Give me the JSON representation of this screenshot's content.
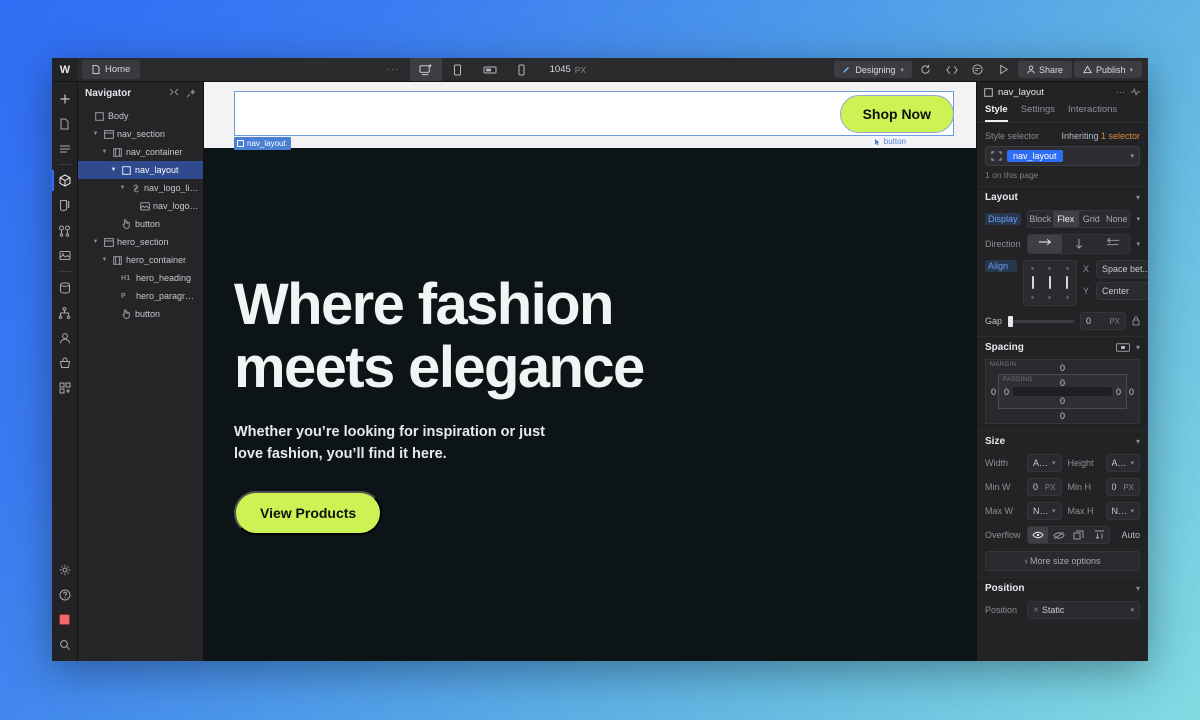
{
  "app": {
    "logo": "W",
    "page_tab": "Home",
    "canvas_width": "1045",
    "canvas_width_unit": "PX",
    "mode_label": "Designing",
    "share_label": "Share",
    "publish_label": "Publish",
    "overflow_dots": "···"
  },
  "rail": {
    "items": [
      {
        "name": "add-panel",
        "icon": "plus-icon"
      },
      {
        "name": "pages-panel",
        "icon": "page-icon"
      },
      {
        "name": "navigator-panel",
        "icon": "layers-icon"
      },
      {
        "name": "components-panel",
        "icon": "cube-icon"
      },
      {
        "name": "style-manager-panel",
        "icon": "paint-icon"
      },
      {
        "name": "variables-panel",
        "icon": "variables-icon"
      },
      {
        "name": "assets-panel",
        "icon": "image-icon"
      },
      {
        "name": "cms-panel",
        "icon": "database-icon"
      },
      {
        "name": "logic-panel",
        "icon": "logic-icon"
      },
      {
        "name": "users-panel",
        "icon": "user-icon"
      },
      {
        "name": "ecommerce-panel",
        "icon": "cart-icon"
      },
      {
        "name": "apps-panel",
        "icon": "apps-icon"
      }
    ],
    "bottom": [
      {
        "name": "settings",
        "icon": "gear-icon"
      },
      {
        "name": "help",
        "icon": "question-icon"
      },
      {
        "name": "color-swatch",
        "icon": "swatch-icon"
      },
      {
        "name": "search",
        "icon": "search-icon"
      }
    ]
  },
  "navigator": {
    "title": "Navigator",
    "tree": [
      {
        "label": "Body",
        "depth": 0,
        "icon": "box-icon",
        "twist": "",
        "selected": false,
        "tag": ""
      },
      {
        "label": "nav_section",
        "depth": 1,
        "icon": "section-icon",
        "twist": "v",
        "selected": false,
        "tag": ""
      },
      {
        "label": "nav_container",
        "depth": 2,
        "icon": "container-icon",
        "twist": "v",
        "selected": false,
        "tag": ""
      },
      {
        "label": "nav_layout",
        "depth": 3,
        "icon": "box-icon",
        "twist": "v",
        "selected": true,
        "tag": ""
      },
      {
        "label": "nav_logo_link",
        "depth": 4,
        "icon": "link-icon",
        "twist": "v",
        "selected": false,
        "tag": ""
      },
      {
        "label": "nav_logo_ima…",
        "depth": 5,
        "icon": "image-icon",
        "twist": "",
        "selected": false,
        "tag": ""
      },
      {
        "label": "button",
        "depth": 3,
        "icon": "pointer-icon",
        "twist": "",
        "selected": false,
        "tag": ""
      },
      {
        "label": "hero_section",
        "depth": 1,
        "icon": "section-icon",
        "twist": "v",
        "selected": false,
        "tag": ""
      },
      {
        "label": "hero_container",
        "depth": 2,
        "icon": "container-icon",
        "twist": "v",
        "selected": false,
        "tag": ""
      },
      {
        "label": "hero_heading",
        "depth": 3,
        "icon": "",
        "twist": "",
        "selected": false,
        "tag": "H1"
      },
      {
        "label": "hero_paragraph",
        "depth": 3,
        "icon": "",
        "twist": "",
        "selected": false,
        "tag": "P"
      },
      {
        "label": "button",
        "depth": 3,
        "icon": "pointer-icon",
        "twist": "",
        "selected": false,
        "tag": ""
      }
    ]
  },
  "canvas": {
    "nav_badge": "nav_layout",
    "button_badge": "button",
    "shop_button": "Shop Now",
    "hero_heading_line1": "Where fashion",
    "hero_heading_line2": "meets elegance",
    "hero_paragraph_line1": "Whether you’re looking for inspiration or just",
    "hero_paragraph_line2": "love fashion, you’ll find it here.",
    "hero_button": "View Products",
    "accent_color": "#ccf254",
    "hero_bg": "#0c1418",
    "selection_blue": "#4a7fd4"
  },
  "style_panel": {
    "element_name": "nav_layout",
    "tabs": [
      {
        "label": "Style",
        "active": true
      },
      {
        "label": "Settings",
        "active": false
      },
      {
        "label": "Interactions",
        "active": false
      }
    ],
    "selector": {
      "label": "Style selector",
      "inherit_prefix": "Inheriting ",
      "inherit_link": "1 selector",
      "chip": "nav_layout",
      "note": "1 on this page"
    },
    "layout": {
      "title": "Layout",
      "display_label": "Display",
      "display_options": [
        "Block",
        "Flex",
        "Grid",
        "None"
      ],
      "display_selected": "Flex",
      "direction_label": "Direction",
      "direction_selected": "row",
      "align_label": "Align",
      "align_x_label": "X",
      "align_x_value": "Space bet...",
      "align_y_label": "Y",
      "align_y_value": "Center",
      "gap_label": "Gap",
      "gap_value": "0",
      "gap_unit": "PX"
    },
    "spacing": {
      "title": "Spacing",
      "margin_label": "MARGIN",
      "padding_label": "PADDING",
      "margin_top": "0",
      "margin_right": "0",
      "margin_bottom": "0",
      "margin_left": "0",
      "padding_top": "0",
      "padding_right": "0",
      "padding_bottom": "0",
      "padding_left": "0"
    },
    "size": {
      "title": "Size",
      "width_label": "Width",
      "width_value": "Auto",
      "height_label": "Height",
      "height_value": "Auto",
      "minw_label": "Min W",
      "minw_value": "0",
      "minw_unit": "PX",
      "minh_label": "Min H",
      "minh_value": "0",
      "minh_unit": "PX",
      "maxw_label": "Max W",
      "maxw_value": "None",
      "maxh_label": "Max H",
      "maxh_value": "None",
      "overflow_label": "Overflow",
      "overflow_auto": "Auto",
      "more_options": "More size options"
    },
    "position": {
      "title": "Position",
      "label": "Position",
      "value": "Static"
    }
  }
}
